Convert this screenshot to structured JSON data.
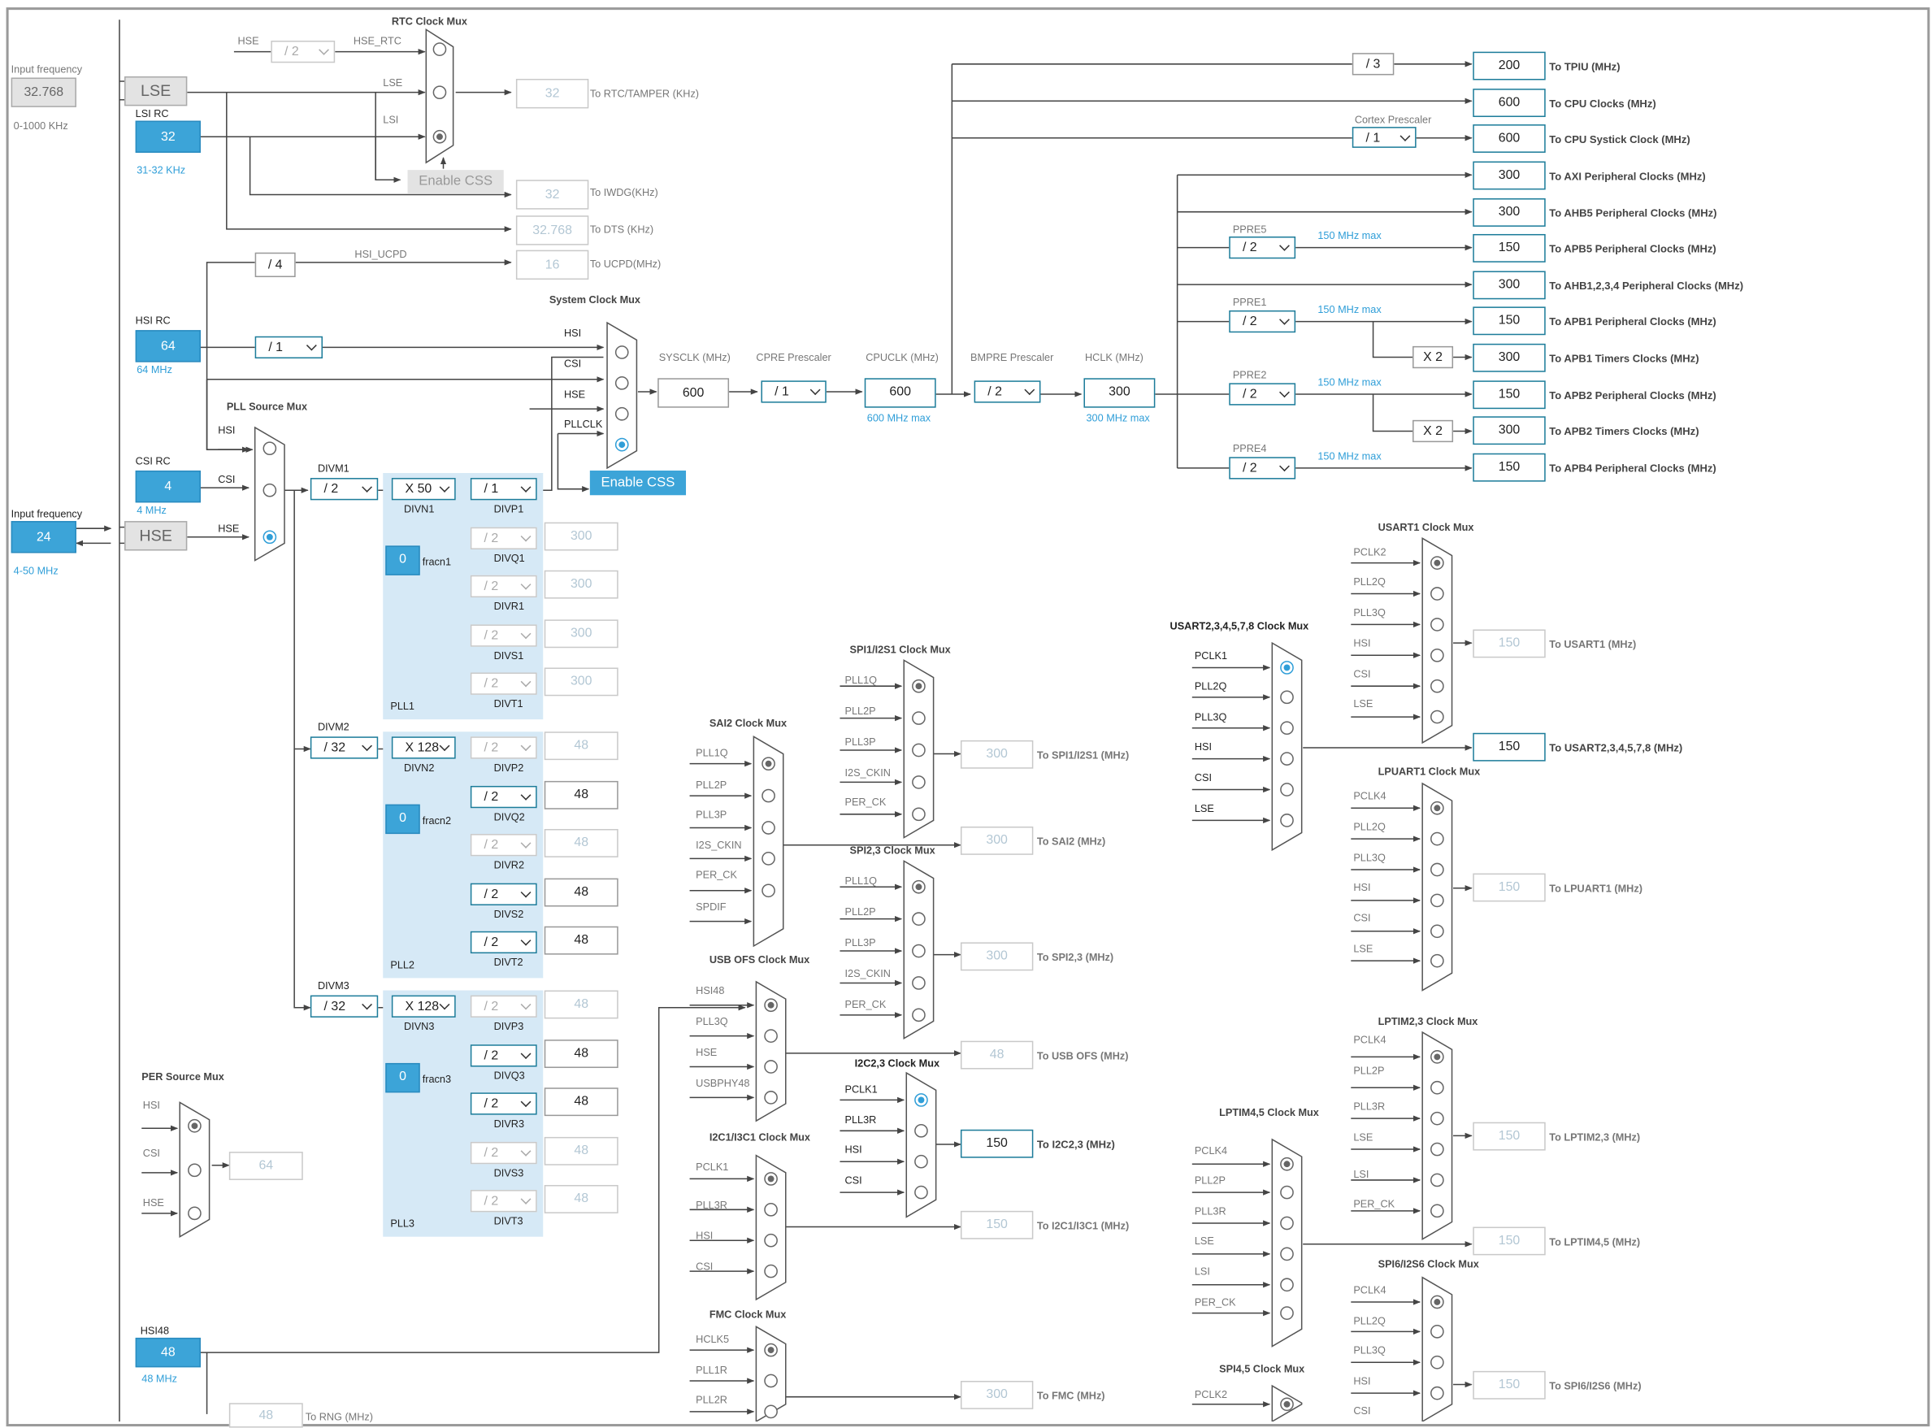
{
  "labels": {
    "input_freq_top": "Input frequency",
    "input_freq_bottom": "Input frequency",
    "lse_range": "0-1000 KHz",
    "lsi_rc": "LSI RC",
    "lsi_range": "31-32 KHz",
    "hsi_rc": "HSI RC",
    "hsi_range": "64 MHz",
    "csi_rc": "CSI RC",
    "csi_range": "4 MHz",
    "hse_range": "4-50 MHz",
    "hsi48_title": "HSI48",
    "hsi48_range": "48 MHz",
    "rtc_mux": "RTC Clock Mux",
    "system_mux": "System Clock Mux",
    "pll_source_mux": "PLL Source Mux",
    "per_source_mux": "PER Source Mux",
    "sysclk": "SYSCLK (MHz)",
    "cpre": "CPRE Prescaler",
    "cpuclk": "CPUCLK (MHz)",
    "bmpre": "BMPRE Prescaler",
    "hclk": "HCLK (MHz)",
    "cpu_max": "600 MHz max",
    "hclk_max": "300 MHz max",
    "cortex_prescaler": "Cortex Prescaler",
    "ppre5": "PPRE5",
    "ppre1": "PPRE1",
    "ppre2": "PPRE2",
    "ppre4": "PPRE4",
    "max150": "150 MHz max",
    "hse_w": "HSE",
    "hse_rtc": "HSE_RTC",
    "lse_w": "LSE",
    "lsi_w": "LSI",
    "hsi_ucpd": "HSI_UCPD",
    "hsi_w": "HSI",
    "csi_w": "CSI",
    "pllclk": "PLLCLK",
    "divm1": "DIVM1",
    "divm2": "DIVM2",
    "divm3": "DIVM3",
    "divn1": "DIVN1",
    "divn2": "DIVN2",
    "divn3": "DIVN3",
    "divp1": "DIVP1",
    "divq1": "DIVQ1",
    "divr1": "DIVR1",
    "divs1": "DIVS1",
    "divt1": "DIVT1",
    "divp2": "DIVP2",
    "divq2": "DIVQ2",
    "divr2": "DIVR2",
    "divs2": "DIVS2",
    "divt2": "DIVT2",
    "divp3": "DIVP3",
    "divq3": "DIVQ3",
    "divr3": "DIVR3",
    "divs3": "DIVS3",
    "divt3": "DIVT3",
    "fracn1": "fracn1",
    "fracn2": "fracn2",
    "fracn3": "fracn3",
    "pll1": "PLL1",
    "pll2": "PLL2",
    "pll3": "PLL3",
    "sai2_mux": "SAI2 Clock Mux",
    "spi1_mux": "SPI1/I2S1 Clock Mux",
    "spi23_mux": "SPI2,3 Clock Mux",
    "usbofs_mux": "USB OFS Clock Mux",
    "i2c23_mux": "I2C2,3 Clock Mux",
    "i2c1_mux": "I2C1/I3C1 Clock Mux",
    "fmc_mux": "FMC Clock Mux",
    "usart2_mux": "USART2,3,4,5,7,8 Clock Mux",
    "usart1_mux": "USART1 Clock Mux",
    "lpuart1_mux": "LPUART1 Clock Mux",
    "lptim23_mux": "LPTIM2,3  Clock Mux",
    "lptim45_mux": "LPTIM4,5 Clock Mux",
    "spi6_mux": "SPI6/I2S6 Clock Mux",
    "spi45_mux": "SPI4,5 Clock Mux",
    "pll1q": "PLL1Q",
    "pll2p": "PLL2P",
    "pll3p": "PLL3P",
    "i2s_ckin": "I2S_CKIN",
    "per_ck": "PER_CK",
    "spdif": "SPDIF",
    "hsi48": "HSI48",
    "pll3q": "PLL3Q",
    "usbphy48": "USBPHY48",
    "pclk1": "PCLK1",
    "pll3r": "PLL3R",
    "pll2q": "PLL2Q",
    "pclk2": "PCLK2",
    "pclk4": "PCLK4",
    "pll2r": "PLL2R",
    "hclk5": "HCLK5",
    "pll1r": "PLL1R",
    "lsi_c": "LSI",
    "lse_c": "LSE"
  },
  "outputs": {
    "tpiu": "To TPIU (MHz)",
    "cpu": "To CPU Clocks (MHz)",
    "systick": "To CPU Systick Clock (MHz)",
    "axi": "To AXI Peripheral Clocks (MHz)",
    "ahb5": "To AHB5 Peripheral Clocks  (MHz)",
    "apb5": "To APB5 Peripheral Clocks (MHz)",
    "ahb1234": "To AHB1,2,3,4 Peripheral Clocks (MHz)",
    "apb1": "To APB1 Peripheral Clocks (MHz)",
    "apb1t": "To APB1 Timers Clocks (MHz)",
    "apb2": "To APB2 Peripheral Clocks (MHz)",
    "apb2t": "To APB2 Timers Clocks (MHz)",
    "apb4": "To APB4 Peripheral Clocks (MHz)",
    "rtc": "To RTC/TAMPER (KHz)",
    "iwdg": "To IWDG(KHz)",
    "dts": "To DTS (KHz)",
    "ucpd": "To UCPD(MHz)",
    "spi1": "To SPI1/I2S1 (MHz)",
    "sai2": "To SAI2 (MHz)",
    "spi23": "To SPI2,3 (MHz)",
    "usbofs": "To USB OFS (MHz)",
    "i2c23": "To I2C2,3 (MHz)",
    "i2c1": "To I2C1/I3C1 (MHz)",
    "fmc": "To FMC (MHz)",
    "rng": "To RNG (MHz)",
    "usart1": "To USART1 (MHz)",
    "usart2": "To USART2,3,4,5,7,8 (MHz)",
    "lpuart1": "To LPUART1 (MHz)",
    "lptim23": "To LPTIM2,3 (MHz)",
    "lptim45": "To LPTIM4,5 (MHz)",
    "spi6": "To SPI6/I2S6 (MHz)"
  },
  "values": {
    "lse_in": "32.768",
    "lse": "LSE",
    "lsi": "32",
    "hse_in": "24",
    "hse": "HSE",
    "hsi": "64",
    "csi": "4",
    "hsi48": "48",
    "rtc_div": "/ 2",
    "ucpd_div": "/ 4",
    "hsi_div": "/ 1",
    "rtc_out": "32",
    "iwdg_out": "32",
    "dts_out": "32.768",
    "ucpd_out": "16",
    "sysclk": "600",
    "cpre": "/ 1",
    "cpuclk": "600",
    "bmpre": "/ 2",
    "hclk": "300",
    "tpiu_div": "/ 3",
    "tpiu": "200",
    "cpu": "600",
    "systick_div": "/ 1",
    "systick": "600",
    "axi": "300",
    "ahb5": "300",
    "ppre5": "/ 2",
    "apb5": "150",
    "ahb1234": "300",
    "ppre1": "/ 2",
    "apb1": "150",
    "x2a": "X 2",
    "apb1t": "300",
    "ppre2": "/ 2",
    "apb2": "150",
    "x2b": "X 2",
    "apb2t": "300",
    "ppre4": "/ 2",
    "apb4": "150",
    "divm1": "/ 2",
    "divn1": "X 50",
    "divp1": "/ 1",
    "divq1": "/ 2",
    "divr1": "/ 2",
    "divs1": "/ 2",
    "divt1": "/ 2",
    "pll1q_out": "300",
    "pll1r_out": "300",
    "pll1s_out": "300",
    "pll1t_out": "300",
    "fracn1": "0",
    "divm2": "/ 32",
    "divn2": "X 128",
    "divp2": "/ 2",
    "divq2": "/ 2",
    "divr2": "/ 2",
    "divs2": "/ 2",
    "divt2": "/ 2",
    "pll2p_out": "48",
    "pll2q_out": "48",
    "pll2r_out": "48",
    "pll2s_out": "48",
    "pll2t_out": "48",
    "fracn2": "0",
    "divm3": "/ 32",
    "divn3": "X 128",
    "divp3": "/ 2",
    "divq3": "/ 2",
    "divr3": "/ 2",
    "divs3": "/ 2",
    "divt3": "/ 2",
    "pll3p_out": "48",
    "pll3q_out": "48",
    "pll3r_out": "48",
    "pll3s_out": "48",
    "pll3t_out": "48",
    "fracn3": "0",
    "per_out": "64",
    "spi1_out": "300",
    "sai2_out": "300",
    "spi23_out": "300",
    "usbofs_out": "48",
    "i2c23_out": "150",
    "i2c1_out": "150",
    "fmc_out": "300",
    "rng_out": "48",
    "usart1_out": "150",
    "usart2_out": "150",
    "lpuart1_out": "150",
    "lptim23_out": "150",
    "lptim45_out": "150",
    "spi6_out": "150"
  },
  "buttons": {
    "enable_css_rtc": "Enable CSS",
    "enable_css_sys": "Enable CSS"
  },
  "colors": {
    "wire": "#444444",
    "accent": "#3ca4d8",
    "box_border": "#1c7c9a",
    "pll_bg": "#d6e9f6"
  }
}
